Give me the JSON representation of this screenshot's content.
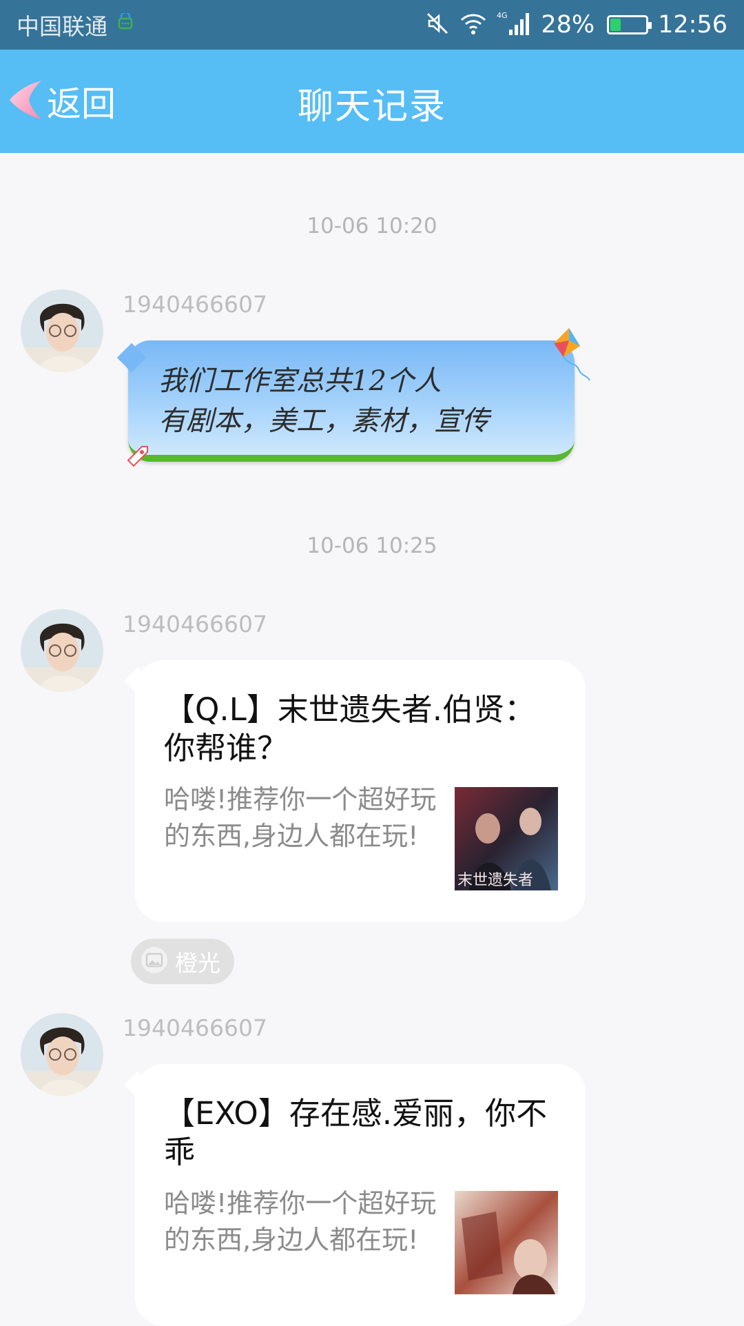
{
  "status_bar": {
    "carrier": "中国联通",
    "signal_label": "4G",
    "battery": "28%",
    "battery_level": 0.28,
    "time": "12:56"
  },
  "header": {
    "back_label": "返回",
    "title": "聊天记录"
  },
  "messages": [
    {
      "timestamp": "10-06 10:20",
      "sender": "1940466607",
      "type": "text",
      "lines": [
        "我们工作室总共12个人",
        "有剧本，美工，素材，宣传"
      ]
    },
    {
      "timestamp": "10-06 10:25",
      "sender": "1940466607",
      "type": "card",
      "title": "【Q.L】末世遗失者.伯贤：你帮谁？",
      "desc": "哈喽!推荐你一个超好玩的东西,身边人都在玩!",
      "thumb_text": "末世遗失者",
      "source": "橙光"
    },
    {
      "sender": "1940466607",
      "type": "card",
      "title": "【EXO】存在感.爱丽，你不乖",
      "desc": "哈喽!推荐你一个超好玩的东西,身边人都在玩!"
    }
  ],
  "colors": {
    "status_bar": "#357399",
    "header": "#56bdf5",
    "background": "#f7f7f9"
  }
}
